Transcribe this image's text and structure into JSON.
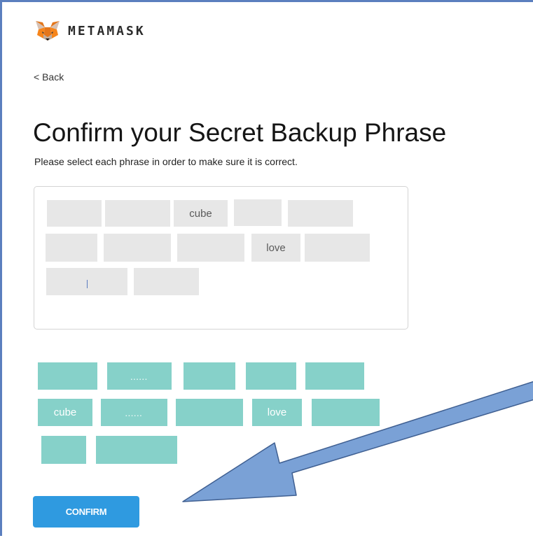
{
  "header": {
    "brand": "METAMASK",
    "logo_icon": "fox-icon"
  },
  "nav": {
    "back_label": "< Back"
  },
  "page": {
    "title": "Confirm your Secret Backup Phrase",
    "instruction": "Please select each phrase in order to make sure it is correct."
  },
  "selected_slots": [
    {
      "word": ""
    },
    {
      "word": ""
    },
    {
      "word": "cube"
    },
    {
      "word": ""
    },
    {
      "word": ""
    },
    {
      "word": ""
    },
    {
      "word": ""
    },
    {
      "word": ""
    },
    {
      "word": "love"
    },
    {
      "word": ""
    },
    {
      "word": ""
    },
    {
      "word": ""
    }
  ],
  "word_chips": [
    {
      "word": ""
    },
    {
      "word": ""
    },
    {
      "word": ""
    },
    {
      "word": ""
    },
    {
      "word": ""
    },
    {
      "word": "cube"
    },
    {
      "word": ""
    },
    {
      "word": ""
    },
    {
      "word": "love"
    },
    {
      "word": ""
    },
    {
      "word": ""
    },
    {
      "word": ""
    }
  ],
  "actions": {
    "confirm_label": "CONFIRM"
  },
  "colors": {
    "chip": "#86d1c9",
    "slot": "#e7e7e7",
    "confirm": "#2f9ae0",
    "arrow": "#7aa1d6",
    "frame": "#5b7fbe"
  }
}
